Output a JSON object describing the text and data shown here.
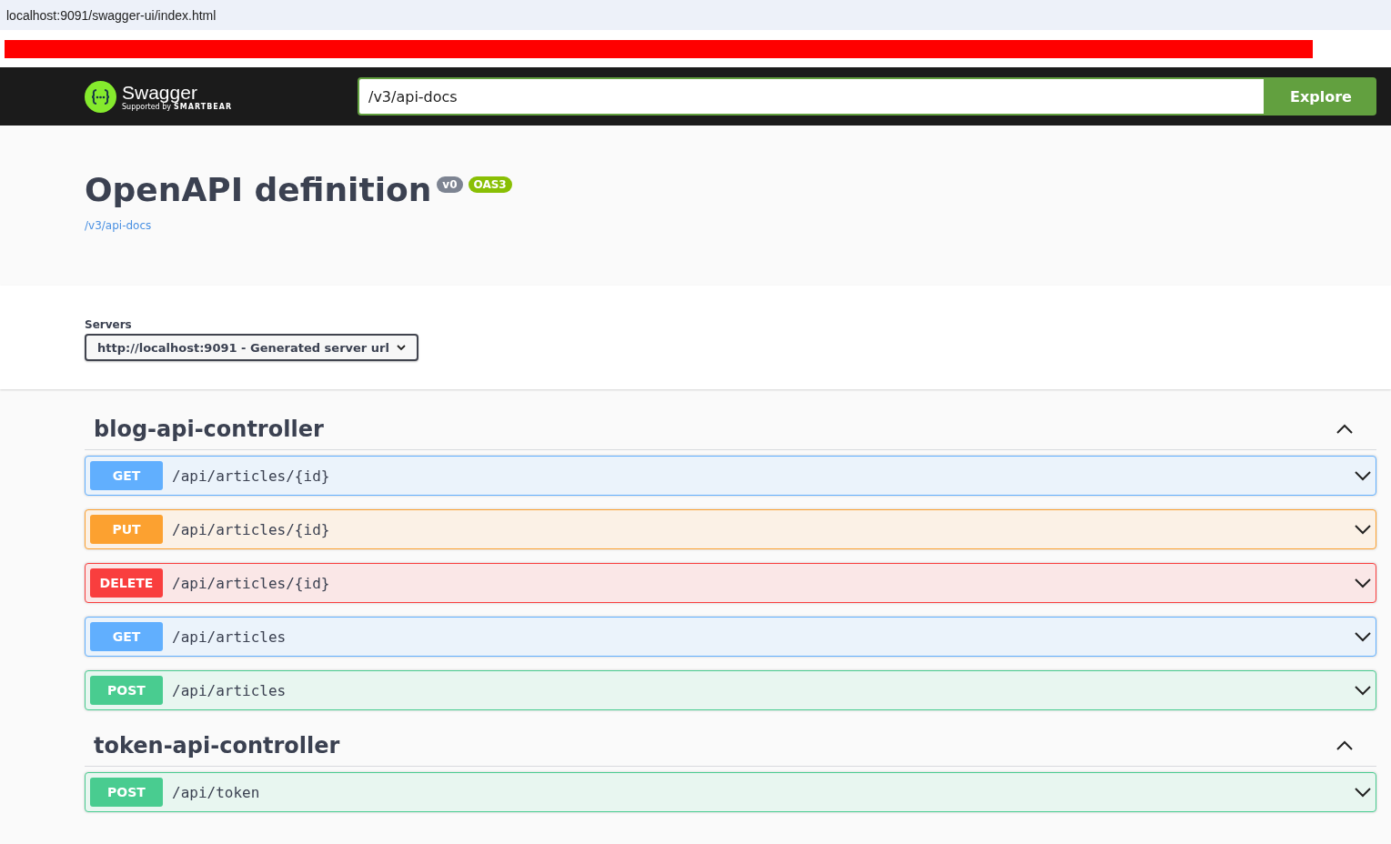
{
  "address_bar": {
    "url": "localhost:9091/swagger-ui/index.html"
  },
  "topbar": {
    "logo_text": "Swagger",
    "logo_sub": "Supported by",
    "logo_brand": "SMARTBEAR",
    "url_input": "/v3/api-docs",
    "explore_button": "Explore"
  },
  "info": {
    "title": "OpenAPI definition",
    "version_badge": "v0",
    "spec_badge": "OAS3",
    "spec_link": "/v3/api-docs"
  },
  "servers": {
    "label": "Servers",
    "selected_server": "http://localhost:9091 - Generated server url"
  },
  "sections": [
    {
      "name": "blog-api-controller",
      "expanded": true,
      "operations": [
        {
          "kind": "get",
          "method": "GET",
          "path": "/api/articles/{id}",
          "expanded": false
        },
        {
          "kind": "put",
          "method": "PUT",
          "path": "/api/articles/{id}",
          "expanded": false
        },
        {
          "kind": "delete",
          "method": "DELETE",
          "path": "/api/articles/{id}",
          "expanded": false
        },
        {
          "kind": "get",
          "method": "GET",
          "path": "/api/articles",
          "expanded": false
        },
        {
          "kind": "post",
          "method": "POST",
          "path": "/api/articles",
          "expanded": false
        }
      ]
    },
    {
      "name": "token-api-controller",
      "expanded": true,
      "operations": [
        {
          "kind": "post",
          "method": "POST",
          "path": "/api/token",
          "expanded": false
        }
      ]
    }
  ]
}
